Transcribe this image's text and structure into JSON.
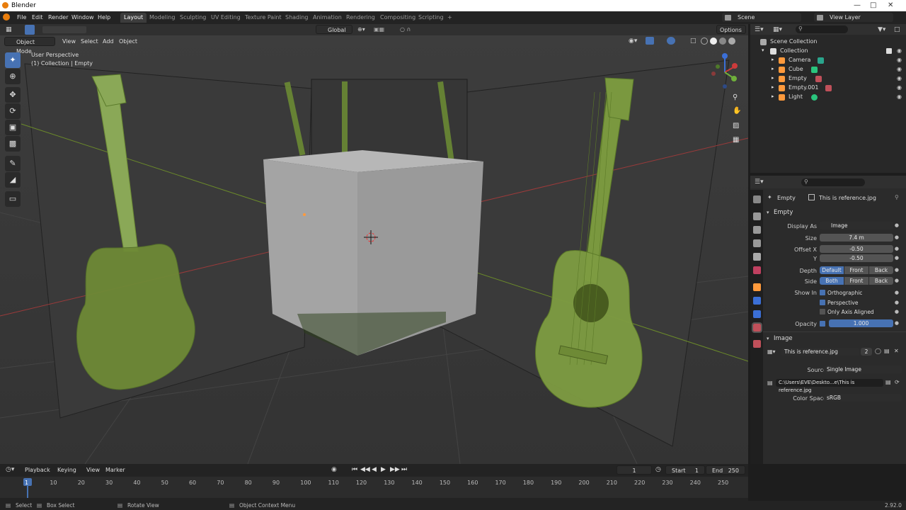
{
  "window": {
    "title": "Blender"
  },
  "menus": [
    "File",
    "Edit",
    "Render",
    "Window",
    "Help"
  ],
  "workspaces": [
    "Layout",
    "Modeling",
    "Sculpting",
    "UV Editing",
    "Texture Paint",
    "Shading",
    "Animation",
    "Rendering",
    "Compositing",
    "Scripting",
    "+"
  ],
  "scene": {
    "name": "Scene",
    "view_layer": "View Layer"
  },
  "toolbar": {
    "transform_orientation": "Global",
    "options": "Options"
  },
  "viewport": {
    "mode": "Object Mode",
    "menus": [
      "View",
      "Select",
      "Add",
      "Object"
    ],
    "overlay_line1": "User Perspective",
    "overlay_line2": "(1) Collection | Empty"
  },
  "outliner": {
    "root": "Scene Collection",
    "collection": "Collection",
    "items": [
      {
        "name": "Camera",
        "icon_color": "#ff9a3c",
        "data_color": "#2aa58c"
      },
      {
        "name": "Cube",
        "icon_color": "#ff9a3c",
        "data_color": "#2ac47d"
      },
      {
        "name": "Empty",
        "icon_color": "#ff9a3c",
        "data_color": "#c0505a"
      },
      {
        "name": "Empty.001",
        "icon_color": "#ff9a3c",
        "data_color": "#c0505a"
      },
      {
        "name": "Light",
        "icon_color": "#ff9a3c",
        "data_color": "#2ac47d"
      }
    ]
  },
  "properties": {
    "object_name": "Empty",
    "data_name": "This is reference.jpg",
    "empty_panel": "Empty",
    "display_as_label": "Display As",
    "display_as": "Image",
    "size_label": "Size",
    "size": "7.4 m",
    "offset_x_label": "Offset X",
    "offset_x": "-0.50",
    "offset_y_label": "Y",
    "offset_y": "-0.50",
    "depth_label": "Depth",
    "depth_options": [
      "Default",
      "Front",
      "Back"
    ],
    "side_label": "Side",
    "side_options": [
      "Both",
      "Front",
      "Back"
    ],
    "show_in_label": "Show In",
    "show_in": [
      "Orthographic",
      "Perspective",
      "Only Axis Aligned"
    ],
    "opacity_label": "Opacity",
    "opacity": "1.000",
    "image_panel": "Image",
    "image_name": "This is reference.jpg",
    "image_users": "2",
    "source_label": "Source",
    "source": "Single Image",
    "filepath": "C:\\Users\\EVE\\Deskto...e\\This is reference.jpg",
    "color_space_label": "Color Space",
    "color_space": "sRGB"
  },
  "timeline": {
    "menus": [
      "Playback",
      "Keying",
      "View",
      "Marker"
    ],
    "current_frame": "1",
    "start_label": "Start",
    "start": "1",
    "end_label": "End",
    "end": "250",
    "ticks": [
      "1",
      "10",
      "20",
      "30",
      "40",
      "50",
      "60",
      "70",
      "80",
      "90",
      "100",
      "110",
      "120",
      "130",
      "140",
      "150",
      "160",
      "170",
      "180",
      "190",
      "200",
      "210",
      "220",
      "230",
      "240",
      "250"
    ]
  },
  "statusbar": {
    "select": "Select",
    "box_select": "Box Select",
    "rotate_view": "Rotate View",
    "context_menu": "Object Context Menu",
    "version": "2.92.0"
  },
  "colors": {
    "accent": "#4772b3",
    "guitar": "#6e8a36",
    "cube": "#9a9a9a"
  }
}
